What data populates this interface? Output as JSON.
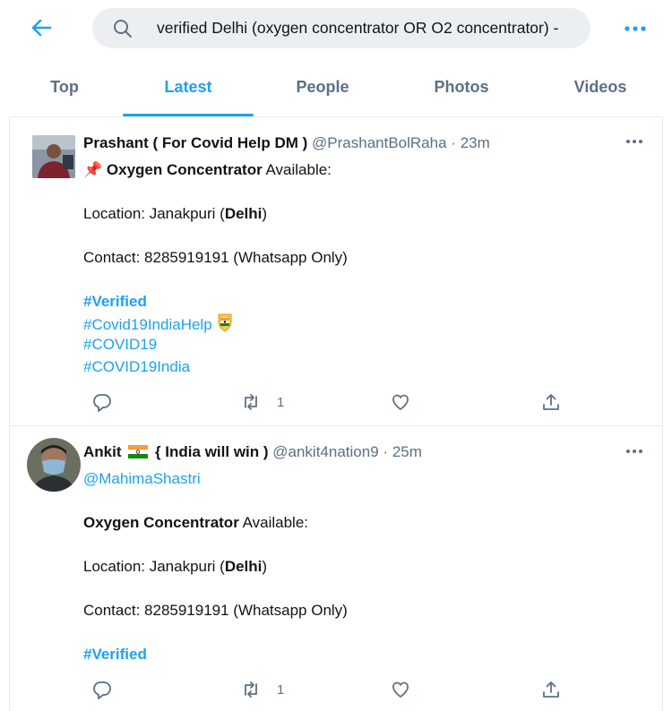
{
  "search": {
    "query": "verified Delhi (oxygen concentrator OR O2 concentrator) -"
  },
  "tabs": [
    {
      "label": "Top"
    },
    {
      "label": "Latest"
    },
    {
      "label": "People"
    },
    {
      "label": "Photos"
    },
    {
      "label": "Videos"
    }
  ],
  "active_tab": "Latest",
  "colors": {
    "accent": "#1da1f2",
    "muted": "#5b7083",
    "text": "#0f1419"
  },
  "tweets": [
    {
      "name": "Prashant ( For Covid Help DM )",
      "handle": "@PrashantBolRaha",
      "sep": "·",
      "time": "23m",
      "pin_emoji": "📌",
      "title_bold": "Oxygen Concentrator",
      "title_rest": " Available:",
      "location_prefix": "Location: Janakpuri (",
      "location_bold": "Delhi",
      "location_suffix": ")",
      "contact": "Contact: 8285919191 (Whatsapp Only)",
      "hashtags": [
        "#Verified",
        "#Covid19IndiaHelp",
        "#COVID19",
        "#COVID19India"
      ],
      "retweet_count": "1"
    },
    {
      "name": "Ankit",
      "name_suffix": "{ India will win )",
      "handle": "@ankit4nation9",
      "sep": "·",
      "time": "25m",
      "mention": "@MahimaShastri",
      "title_bold": "Oxygen Concentrator",
      "title_rest": " Available:",
      "location_prefix": "Location: Janakpuri (",
      "location_bold": "Delhi",
      "location_suffix": ")",
      "contact": "Contact: 8285919191 (Whatsapp Only)",
      "hashtags": [
        "#Verified"
      ],
      "retweet_count": "1"
    }
  ]
}
